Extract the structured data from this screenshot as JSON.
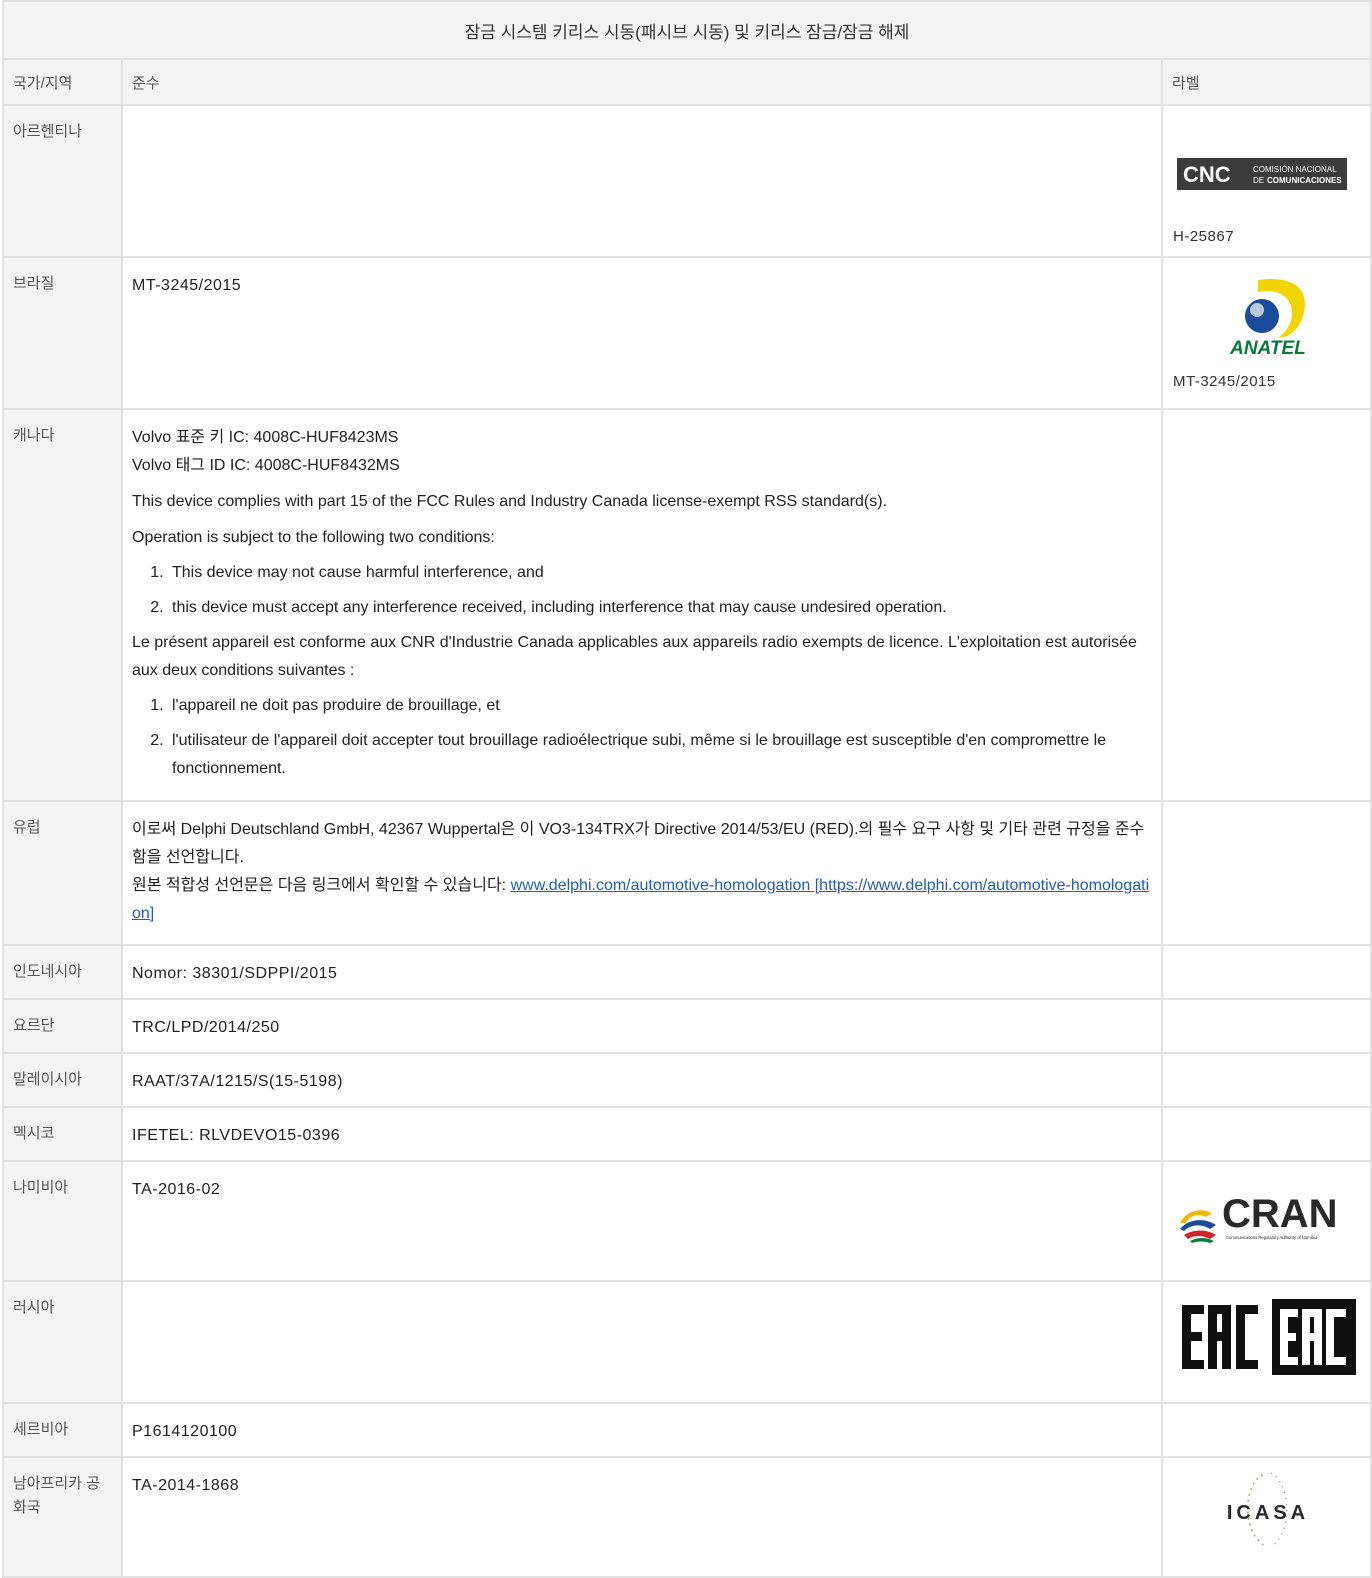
{
  "table": {
    "title": "잠금 시스템 키리스 시동(패시브 시동) 및 키리스 잠금/잠금 해제",
    "headers": {
      "country": "국가/지역",
      "compliance": "준수",
      "label": "라벨"
    },
    "rows": {
      "argentina": {
        "country": "아르헨티나",
        "label_text": "H-25867",
        "logo": "CNC logo",
        "logo_text": {
          "main": "CNC",
          "line1": "COMISIÓN NACIONAL",
          "line2_prefix": "DE",
          "line2": "COMUNICACIONES"
        }
      },
      "brazil": {
        "country": "브라질",
        "compliance": "MT-3245/2015",
        "label_text": "MT-3245/2015",
        "logo": "ANATEL logo",
        "logo_text": "ANATEL"
      },
      "canada": {
        "country": "캐나다",
        "line1": "Volvo 표준 키 IC: 4008C-HUF8423MS",
        "line2": "Volvo 태그 ID IC: 4008C-HUF8432MS",
        "line3": "This device complies with part 15 of the FCC Rules and Industry Canada license-exempt RSS standard(s).",
        "line4": "Operation is subject to the following two conditions:",
        "en_items": [
          "This device may not cause harmful interference, and",
          "this device must accept any interference received, including interference that may cause undesired operation."
        ],
        "fr_para": "Le présent appareil est conforme aux CNR d'Industrie Canada applicables aux appareils radio exempts de licence. L'exploitation est autorisée aux deux conditions suivantes :",
        "fr_items": [
          "l'appareil ne doit pas produire de brouillage, et",
          "l'utilisateur de l'appareil doit accepter tout brouillage radioélectrique subi, même si le brouillage est susceptible d'en compromettre le fonctionnement."
        ]
      },
      "europe": {
        "country": "유럽",
        "text1": "이로써 Delphi Deutschland GmbH, 42367 Wuppertal은 이 VO3-134TRX가 Directive 2014/53/EU (RED).의 필수 요구 사항 및 기타 관련 규정을 준수함을 선언합니다.",
        "text2_prefix": "원본 적합성 선언문은 다음 링크에서 확인할 수 있습니다: ",
        "link_text": "www.delphi.com/automotive-homologation [https://www.delphi.com/automotive-homologation]"
      },
      "indonesia": {
        "country": "인도네시아",
        "compliance": "Nomor: 38301/SDPPI/2015"
      },
      "jordan": {
        "country": "요르단",
        "compliance": "TRC/LPD/2014/250"
      },
      "malaysia": {
        "country": "말레이시아",
        "compliance": "RAAT/37A/1215/S(15-5198)"
      },
      "mexico": {
        "country": "멕시코",
        "compliance": "IFETEL: RLVDEVO15-0396"
      },
      "namibia": {
        "country": "나미비아",
        "compliance": "TA-2016-02",
        "logo": "CRAN logo",
        "logo_text": "CRAN",
        "logo_sub": "Communications Regulatory Authority of Namibia"
      },
      "russia": {
        "country": "러시아",
        "logo": "EAC mark",
        "logo_text": "EAC"
      },
      "serbia": {
        "country": "세르비아",
        "compliance": "P1614120100"
      },
      "south_africa": {
        "country": "남아프리카 공화국",
        "compliance": "TA-2014-1868",
        "logo": "ICASA logo",
        "logo_text": "ICASA"
      }
    }
  },
  "colors": {
    "header_bg": "#f3f3f3",
    "border": "#e1e1e1",
    "link": "#1f5fb7",
    "anatel_yellow": "#f2d400",
    "anatel_blue": "#1a4b9c",
    "anatel_green": "#0a7a3a"
  }
}
